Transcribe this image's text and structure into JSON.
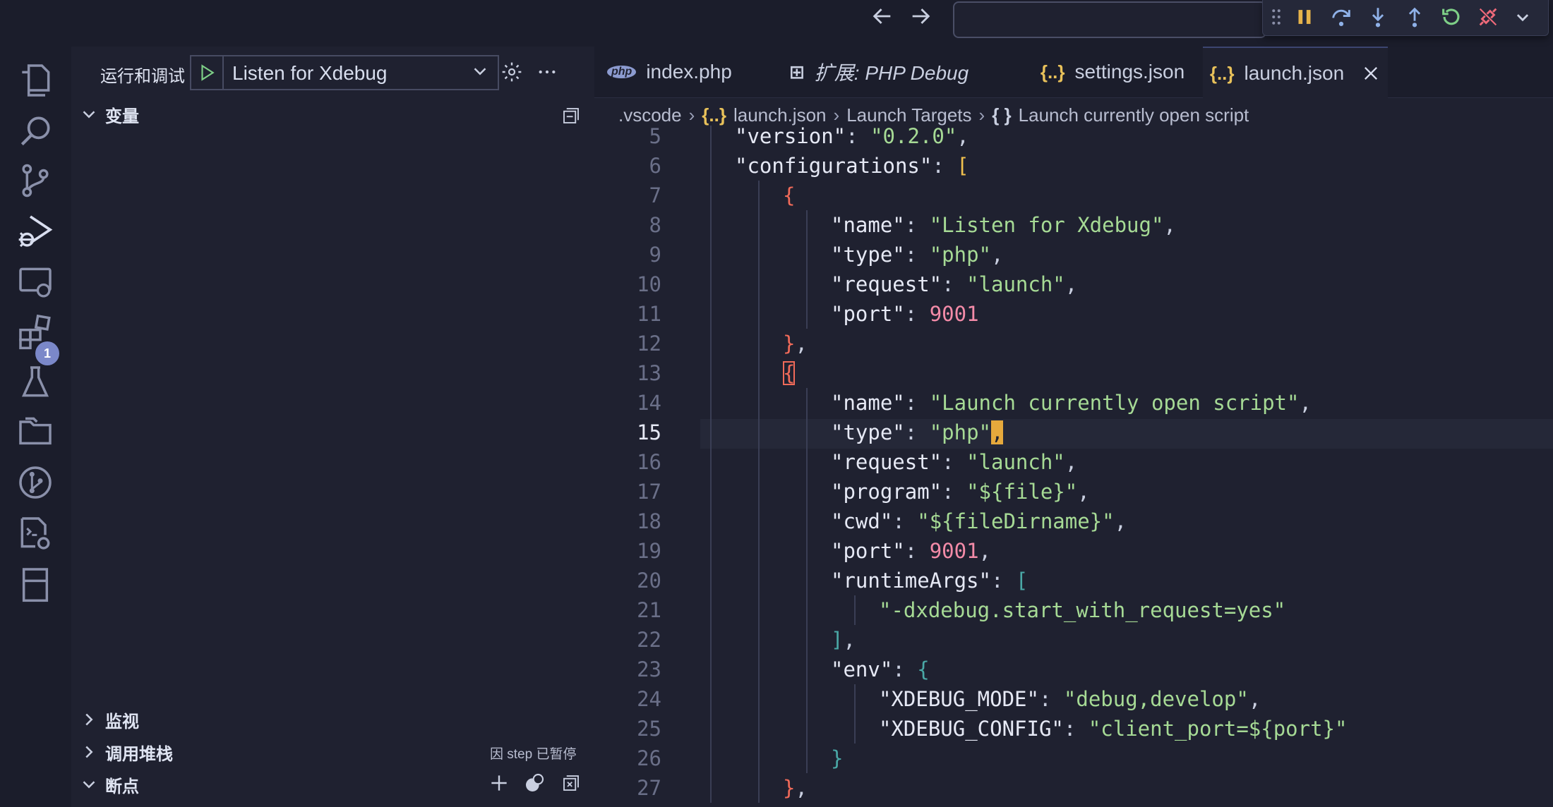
{
  "titlebar": {
    "back_icon": "arrow-left-icon",
    "forward_icon": "arrow-right-icon",
    "command_center_value": ""
  },
  "debug_toolbar": {
    "actions": [
      "gripper",
      "pause",
      "step-over",
      "step-into",
      "step-out",
      "restart",
      "disconnect"
    ]
  },
  "activity_bar": {
    "items": [
      "explorer",
      "search",
      "source-control",
      "run-and-debug",
      "remote-explorer",
      "extensions",
      "testing",
      "folders",
      "git-graph",
      "settings-sync",
      "bookmarks"
    ],
    "debug_badge": "1"
  },
  "sidebar": {
    "title": "运行和调试",
    "config_name": "Listen for Xdebug",
    "sections": {
      "variables": "变量",
      "watch": "监视",
      "call_stack": "调用堆栈",
      "call_stack_status": "因 step 已暂停",
      "breakpoints": "断点"
    }
  },
  "tabs": [
    {
      "icon_text": "php",
      "label": "index.php",
      "italic": false,
      "active": false
    },
    {
      "icon_text": "⊞",
      "label": "扩展: PHP Debug",
      "italic": true,
      "active": false
    },
    {
      "icon_text": "{..}",
      "label": "settings.json",
      "italic": false,
      "active": false
    },
    {
      "icon_text": "{..}",
      "label": "launch.json",
      "italic": false,
      "active": true
    }
  ],
  "breadcrumb": {
    "folder": ".vscode",
    "file_icon": "{..}",
    "file": "launch.json",
    "section": "Launch Targets",
    "obj_icon": "{ }",
    "item": "Launch currently open script"
  },
  "editor": {
    "active_line": "15",
    "lines": [
      {
        "n": "5",
        "ind": 1,
        "tokens": [
          [
            "k",
            "\"version\""
          ],
          [
            "p",
            ": "
          ],
          [
            "s",
            "\"0.2.0\""
          ],
          [
            "p",
            ","
          ]
        ]
      },
      {
        "n": "6",
        "ind": 1,
        "tokens": [
          [
            "k",
            "\"configurations\""
          ],
          [
            "p",
            ": "
          ],
          [
            "br-yellow",
            "["
          ]
        ]
      },
      {
        "n": "7",
        "ind": 2,
        "tokens": [
          [
            "br-red",
            "{"
          ]
        ]
      },
      {
        "n": "8",
        "ind": 3,
        "tokens": [
          [
            "k",
            "\"name\""
          ],
          [
            "p",
            ": "
          ],
          [
            "s",
            "\"Listen for Xdebug\""
          ],
          [
            "p",
            ","
          ]
        ]
      },
      {
        "n": "9",
        "ind": 3,
        "tokens": [
          [
            "k",
            "\"type\""
          ],
          [
            "p",
            ": "
          ],
          [
            "s",
            "\"php\""
          ],
          [
            "p",
            ","
          ]
        ]
      },
      {
        "n": "10",
        "ind": 3,
        "tokens": [
          [
            "k",
            "\"request\""
          ],
          [
            "p",
            ": "
          ],
          [
            "s",
            "\"launch\""
          ],
          [
            "p",
            ","
          ]
        ]
      },
      {
        "n": "11",
        "ind": 3,
        "tokens": [
          [
            "k",
            "\"port\""
          ],
          [
            "p",
            ": "
          ],
          [
            "n",
            "9001"
          ]
        ]
      },
      {
        "n": "12",
        "ind": 2,
        "tokens": [
          [
            "br-red",
            "}"
          ],
          [
            "p",
            ","
          ]
        ]
      },
      {
        "n": "13",
        "ind": 2,
        "tokens": [
          [
            "br-red br-box",
            "{"
          ]
        ]
      },
      {
        "n": "14",
        "ind": 3,
        "tokens": [
          [
            "k",
            "\"name\""
          ],
          [
            "p",
            ": "
          ],
          [
            "s",
            "\"Launch currently open script\""
          ],
          [
            "p",
            ","
          ]
        ]
      },
      {
        "n": "15",
        "ind": 3,
        "tokens": [
          [
            "k",
            "\"type\""
          ],
          [
            "p",
            ": "
          ],
          [
            "s",
            "\"php\""
          ],
          [
            "caret-hl",
            ","
          ]
        ]
      },
      {
        "n": "16",
        "ind": 3,
        "tokens": [
          [
            "k",
            "\"request\""
          ],
          [
            "p",
            ": "
          ],
          [
            "s",
            "\"launch\""
          ],
          [
            "p",
            ","
          ]
        ]
      },
      {
        "n": "17",
        "ind": 3,
        "tokens": [
          [
            "k",
            "\"program\""
          ],
          [
            "p",
            ": "
          ],
          [
            "s",
            "\"${file}\""
          ],
          [
            "p",
            ","
          ]
        ]
      },
      {
        "n": "18",
        "ind": 3,
        "tokens": [
          [
            "k",
            "\"cwd\""
          ],
          [
            "p",
            ": "
          ],
          [
            "s",
            "\"${fileDirname}\""
          ],
          [
            "p",
            ","
          ]
        ]
      },
      {
        "n": "19",
        "ind": 3,
        "tokens": [
          [
            "k",
            "\"port\""
          ],
          [
            "p",
            ": "
          ],
          [
            "n",
            "9001"
          ],
          [
            "p",
            ","
          ]
        ]
      },
      {
        "n": "20",
        "ind": 3,
        "tokens": [
          [
            "k",
            "\"runtimeArgs\""
          ],
          [
            "p",
            ": "
          ],
          [
            "br-teal",
            "["
          ]
        ]
      },
      {
        "n": "21",
        "ind": 4,
        "tokens": [
          [
            "s",
            "\"-dxdebug.start_with_request=yes\""
          ]
        ]
      },
      {
        "n": "22",
        "ind": 3,
        "tokens": [
          [
            "br-teal",
            "]"
          ],
          [
            "p",
            ","
          ]
        ]
      },
      {
        "n": "23",
        "ind": 3,
        "tokens": [
          [
            "k",
            "\"env\""
          ],
          [
            "p",
            ": "
          ],
          [
            "br-teal",
            "{"
          ]
        ]
      },
      {
        "n": "24",
        "ind": 4,
        "tokens": [
          [
            "k",
            "\"XDEBUG_MODE\""
          ],
          [
            "p",
            ": "
          ],
          [
            "s",
            "\"debug,develop\""
          ],
          [
            "p",
            ","
          ]
        ]
      },
      {
        "n": "25",
        "ind": 4,
        "tokens": [
          [
            "k",
            "\"XDEBUG_CONFIG\""
          ],
          [
            "p",
            ": "
          ],
          [
            "s",
            "\"client_port=${port}\""
          ]
        ]
      },
      {
        "n": "26",
        "ind": 3,
        "tokens": [
          [
            "br-teal",
            "}"
          ]
        ]
      },
      {
        "n": "27",
        "ind": 2,
        "tokens": [
          [
            "br-red",
            "}"
          ],
          [
            "p",
            ","
          ]
        ]
      }
    ]
  }
}
